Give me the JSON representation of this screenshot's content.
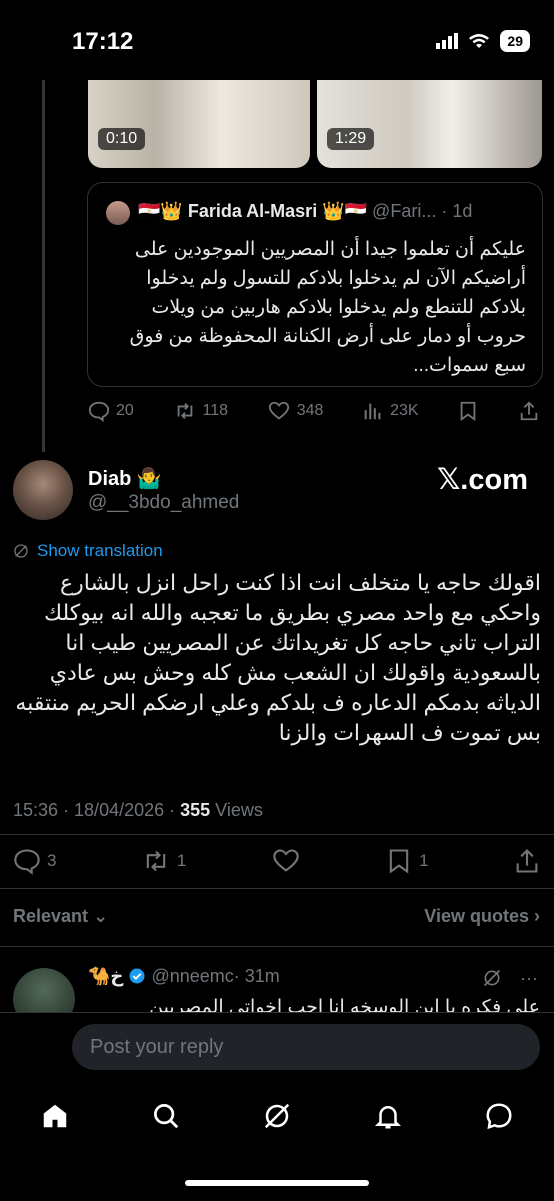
{
  "status_bar": {
    "time": "17:12",
    "battery": "29"
  },
  "media": [
    {
      "duration": "0:10"
    },
    {
      "duration": "1:29"
    }
  ],
  "quote": {
    "name": "🇪🇬👑 Farida Al-Masri 👑🇪🇬",
    "handle": "@Fari...",
    "time": "· 1d",
    "text": "عليكم أن تعلموا جيدا أن المصريين الموجودين على أراضيكم الآن لم يدخلوا بلادكم للتسول ولم يدخلوا بلادكم للتنطع ولم يدخلوا بلادكم هاربين من ويلات حروب أو دمار على أرض الكنانة المحفوظة من فوق سبع سموات..."
  },
  "quote_actions": {
    "replies": "20",
    "reposts": "118",
    "likes": "348",
    "views": "23K"
  },
  "post": {
    "name": "Diab 🤷‍♂️",
    "handle": "@__3bdo_ahmed",
    "source": "𝕏.com",
    "translate": "Show translation",
    "text": "اقولك حاجه يا متخلف انت اذا كنت راحل انزل بالشارع واحكي مع واحد مصري بطريق ما تعجبه والله انه بيوكلك التراب تاني حاجه كل تغريداتك عن المصريين طيب انا بالسعودية واقولك ان الشعب مش كله وحش بس عادي الدياثه بدمكم الدعاره ف بلدكم وعلي ارضكم الحريم منتقبه بس تموت ف السهرات والزنا",
    "timestamp": "15:36 · 18/04/2026 · ",
    "views_count": "355",
    "views_label": " Views"
  },
  "post_actions": {
    "replies": "3",
    "reposts": "1",
    "bookmarks": "1"
  },
  "sort": {
    "relevant": "Relevant",
    "view_quotes": "View quotes"
  },
  "reply": {
    "name": "🐪خ",
    "handle": "@nneemc",
    "time": "· 31m",
    "text": "على فكره يا ابن الوسخه انا احب اخواتي المصريين"
  },
  "composer": {
    "placeholder": "Post your reply"
  },
  "colors": {
    "accent": "#1d9bf0",
    "muted": "#71767b",
    "background": "#000000"
  }
}
